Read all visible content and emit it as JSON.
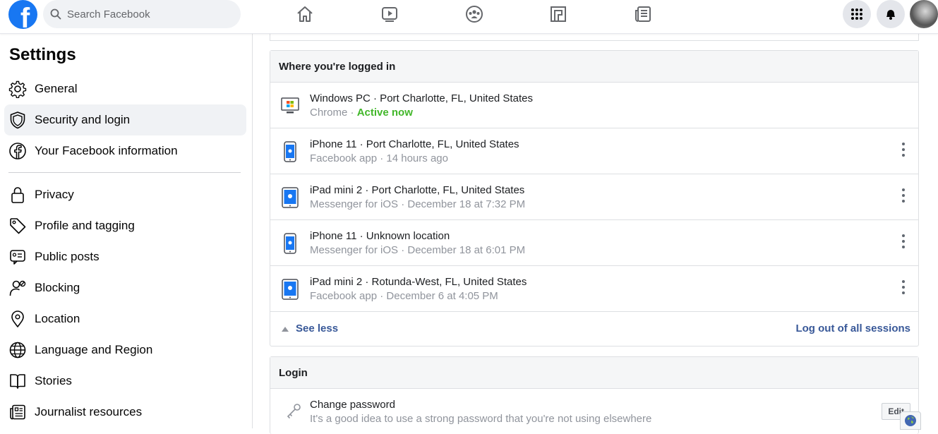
{
  "topbar": {
    "logo": "f",
    "search_placeholder": "Search Facebook",
    "nav_icons": [
      "home-icon",
      "watch-icon",
      "groups-icon",
      "gaming-icon",
      "news-icon"
    ],
    "right_icons": [
      "menu-grid-icon",
      "notifications-bell-icon",
      "profile-avatar"
    ]
  },
  "sidebar": {
    "title": "Settings",
    "items": [
      {
        "label": "General",
        "icon": "gear-icon"
      },
      {
        "label": "Security and login",
        "icon": "shield-icon",
        "active": true
      },
      {
        "label": "Your Facebook information",
        "icon": "facebook-circle-icon"
      },
      {
        "label": "Privacy",
        "icon": "lock-icon"
      },
      {
        "label": "Profile and tagging",
        "icon": "tag-icon"
      },
      {
        "label": "Public posts",
        "icon": "public-posts-icon"
      },
      {
        "label": "Blocking",
        "icon": "blocking-icon"
      },
      {
        "label": "Location",
        "icon": "location-pin-icon"
      },
      {
        "label": "Language and Region",
        "icon": "globe-icon"
      },
      {
        "label": "Stories",
        "icon": "book-icon"
      },
      {
        "label": "Journalist resources",
        "icon": "newspaper-icon"
      }
    ]
  },
  "sessions_card": {
    "title": "Where you're logged in",
    "sessions": [
      {
        "device": "Windows PC · Port Charlotte, FL, United States",
        "app": "Chrome · ",
        "status": "Active now",
        "icon": "windows-pc-icon"
      },
      {
        "device": "iPhone 11 · Port Charlotte, FL, United States",
        "app": "Facebook app · 14 hours ago",
        "icon": "iphone-icon"
      },
      {
        "device": "iPad mini 2 · Port Charlotte, FL, United States",
        "app": "Messenger for iOS · December 18 at 7:32 PM",
        "icon": "ipad-icon"
      },
      {
        "device": "iPhone 11 · Unknown location",
        "app": "Messenger for iOS · December 18 at 6:01 PM",
        "icon": "iphone-icon"
      },
      {
        "device": "iPad mini 2 · Rotunda-West, FL, United States",
        "app": "Facebook app · December 6 at 4:05 PM",
        "icon": "ipad-icon"
      }
    ],
    "see_less": "See less",
    "log_out_all": "Log out of all sessions"
  },
  "login_card": {
    "title": "Login",
    "change_password": {
      "title": "Change password",
      "description": "It's a good idea to use a strong password that you're not using elsewhere",
      "edit_label": "Edit"
    }
  },
  "colors": {
    "brand": "#1877f2",
    "link": "#385898",
    "active_green": "#42b72a"
  }
}
